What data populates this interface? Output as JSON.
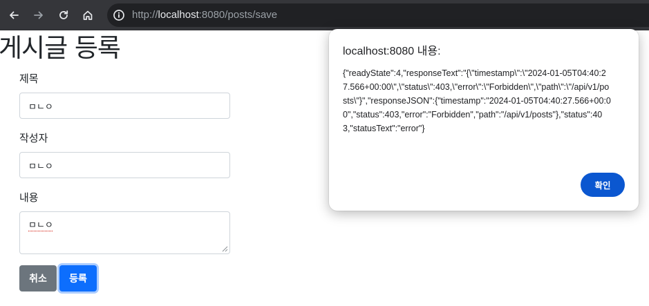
{
  "browser": {
    "url_scheme": "http://",
    "url_host": "localhost",
    "url_rest": ":8080/posts/save",
    "icons": {
      "back": "arrow-left-icon",
      "forward": "arrow-right-icon",
      "reload": "reload-icon",
      "home": "home-icon",
      "site_info": "info-icon"
    }
  },
  "page": {
    "title": "게시글 등록",
    "fields": {
      "title_label": "제목",
      "title_value": "ㅁㄴㅇ",
      "author_label": "작성자",
      "author_value": "ㅁㄴㅇ",
      "content_label": "내용",
      "content_value": "ㅁㄴㅇ"
    },
    "buttons": {
      "cancel": "취소",
      "save": "등록"
    }
  },
  "dialog": {
    "title": "localhost:8080 내용:",
    "message": "{\"readyState\":4,\"responseText\":\"{\\\"timestamp\\\":\\\"2024-01-05T04:40:27.566+00:00\\\",\\\"status\\\":403,\\\"error\\\":\\\"Forbidden\\\",\\\"path\\\":\\\"/api/v1/posts\\\"}\",\"responseJSON\":{\"timestamp\":\"2024-01-05T04:40:27.566+00:00\",\"status\":403,\"error\":\"Forbidden\",\"path\":\"/api/v1/posts\"},\"status\":403,\"statusText\":\"error\"}",
    "ok_label": "확인"
  },
  "colors": {
    "toolbar_bg": "#35363a",
    "primary": "#0d6efd",
    "secondary": "#6c757d",
    "dialog_button": "#0b57d0"
  }
}
